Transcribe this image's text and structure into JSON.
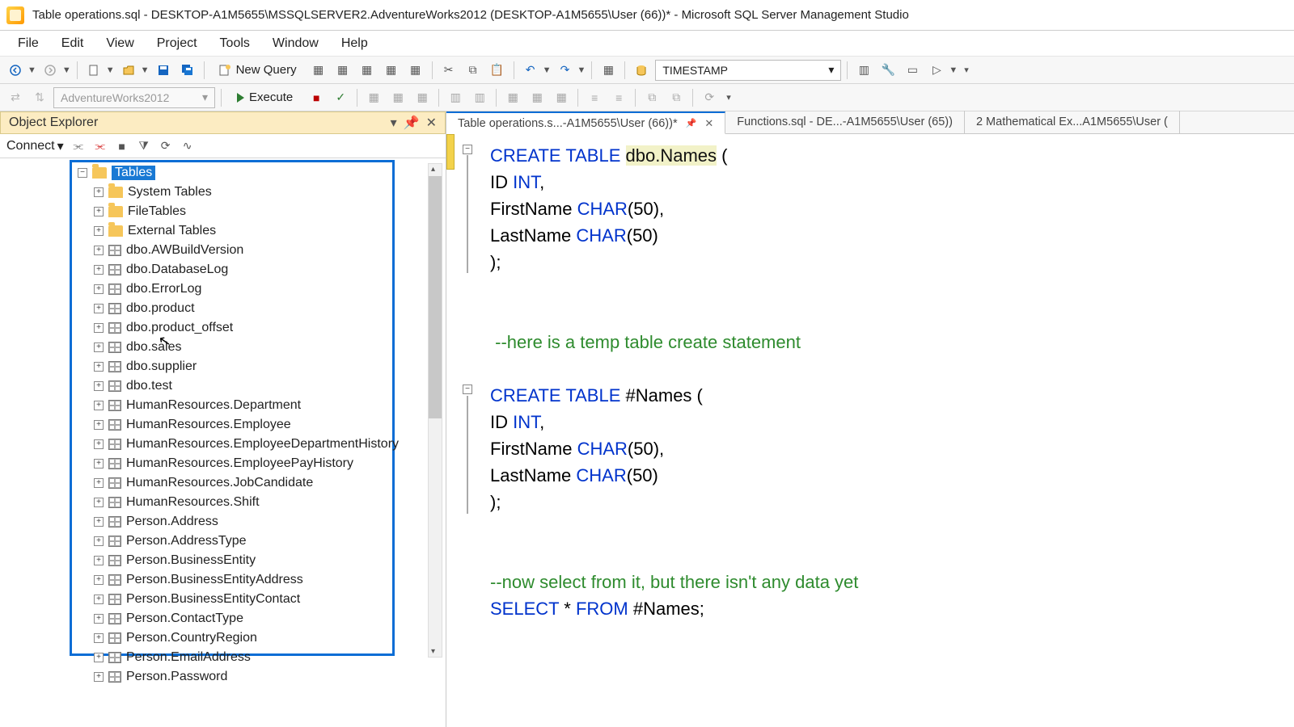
{
  "title": "Table operations.sql - DESKTOP-A1M5655\\MSSQLSERVER2.AdventureWorks2012 (DESKTOP-A1M5655\\User (66))* - Microsoft SQL Server Management Studio",
  "menu": {
    "file": "File",
    "edit": "Edit",
    "view": "View",
    "project": "Project",
    "tools": "Tools",
    "window": "Window",
    "help": "Help"
  },
  "toolbar1": {
    "new_query": "New Query",
    "combo_value": "TIMESTAMP"
  },
  "toolbar2": {
    "db_combo": "AdventureWorks2012",
    "execute": "Execute"
  },
  "oe": {
    "title": "Object Explorer",
    "connect": "Connect",
    "root": "Tables",
    "folders": [
      "System Tables",
      "FileTables",
      "External Tables"
    ],
    "tables": [
      "dbo.AWBuildVersion",
      "dbo.DatabaseLog",
      "dbo.ErrorLog",
      "dbo.product",
      "dbo.product_offset",
      "dbo.sales",
      "dbo.supplier",
      "dbo.test",
      "HumanResources.Department",
      "HumanResources.Employee",
      "HumanResources.EmployeeDepartmentHistory",
      "HumanResources.EmployeePayHistory",
      "HumanResources.JobCandidate",
      "HumanResources.Shift",
      "Person.Address",
      "Person.AddressType",
      "Person.BusinessEntity",
      "Person.BusinessEntityAddress",
      "Person.BusinessEntityContact",
      "Person.ContactType",
      "Person.CountryRegion",
      "Person.EmailAddress",
      "Person.Password"
    ]
  },
  "tabs": {
    "t1": "Table operations.s...-A1M5655\\User (66))*",
    "t2": "Functions.sql - DE...-A1M5655\\User (65))",
    "t3": "2 Mathematical Ex...A1M5655\\User ("
  },
  "code": {
    "l1a": "CREATE",
    "l1b": "TABLE",
    "l1c": "dbo",
    "l1d": ".",
    "l1e": "Names",
    "l1f": " (",
    "l2a": "ID ",
    "l2b": "INT",
    "l2c": ",",
    "l3a": "FirstName ",
    "l3b": "CHAR",
    "l3c": "(",
    "l3d": "50",
    "l3e": "),",
    "l4a": "LastName ",
    "l4b": "CHAR",
    "l4c": "(",
    "l4d": "50",
    "l4e": ")",
    "l5": ");",
    "l7": "--here is a temp table create statement",
    "l8a": "CREATE",
    "l8b": "TABLE",
    "l8c": "#Names (",
    "l9a": "ID ",
    "l9b": "INT",
    "l9c": ",",
    "l10a": "FirstName ",
    "l10b": "CHAR",
    "l10c": "(",
    "l10d": "50",
    "l10e": "),",
    "l11a": "LastName ",
    "l11b": "CHAR",
    "l11c": "(",
    "l11d": "50",
    "l11e": ")",
    "l12": ");",
    "l14": "--now select from it, but there isn't any data yet",
    "l15a": "SELECT",
    "l15b": " * ",
    "l15c": "FROM",
    "l15d": " #Names;"
  }
}
